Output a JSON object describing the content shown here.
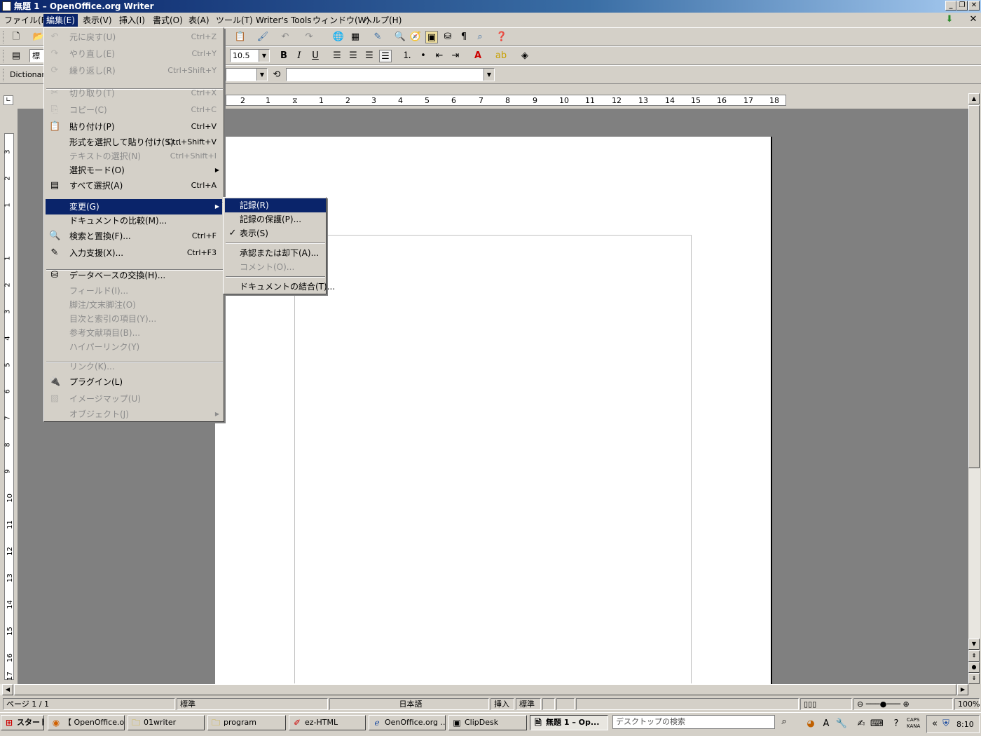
{
  "window": {
    "title": "無題 1 – OpenOffice.org Writer"
  },
  "menubar": [
    {
      "label": "ファイル(F)"
    },
    {
      "label": "編集(E)"
    },
    {
      "label": "表示(V)"
    },
    {
      "label": "挿入(I)"
    },
    {
      "label": "書式(O)"
    },
    {
      "label": "表(A)"
    },
    {
      "label": "ツール(T)"
    },
    {
      "label": "Writer's Tools"
    },
    {
      "label": "ウィンドウ(W)"
    },
    {
      "label": "ヘルプ(H)"
    }
  ],
  "toolbar": {
    "style_value": "標",
    "font_size_value": "10.5",
    "dictionary_label": "Dictionar"
  },
  "edit_menu": [
    {
      "label": "元に戻す(U)",
      "shortcut": "Ctrl+Z",
      "icon": "undo-icon"
    },
    {
      "label": "やり直し(E)",
      "shortcut": "Ctrl+Y",
      "icon": "redo-icon"
    },
    {
      "label": "繰り返し(R)",
      "shortcut": "Ctrl+Shift+Y",
      "icon": "repeat-icon"
    },
    {
      "label": "切り取り(T)",
      "shortcut": "Ctrl+X",
      "icon": "cut-icon"
    },
    {
      "label": "コピー(C)",
      "shortcut": "Ctrl+C",
      "icon": "copy-icon"
    },
    {
      "label": "貼り付け(P)",
      "shortcut": "Ctrl+V",
      "icon": "paste-icon"
    },
    {
      "label": "形式を選択して貼り付け(S)...",
      "shortcut": "Ctrl+Shift+V"
    },
    {
      "label": "テキストの選択(N)",
      "shortcut": "Ctrl+Shift+I"
    },
    {
      "label": "選択モード(O)"
    },
    {
      "label": "すべて選択(A)",
      "shortcut": "Ctrl+A",
      "icon": "select-all-icon"
    },
    {
      "label": "変更(G)"
    },
    {
      "label": "ドキュメントの比較(M)..."
    },
    {
      "label": "検索と置換(F)...",
      "shortcut": "Ctrl+F",
      "icon": "binoculars-icon"
    },
    {
      "label": "入力支援(X)...",
      "shortcut": "Ctrl+F3",
      "icon": "autotext-icon"
    },
    {
      "label": "データベースの交換(H)...",
      "icon": "database-icon"
    },
    {
      "label": "フィールド(I)..."
    },
    {
      "label": "脚注/文末脚注(O)"
    },
    {
      "label": "目次と索引の項目(Y)..."
    },
    {
      "label": "参考文献項目(B)..."
    },
    {
      "label": "ハイパーリンク(Y)"
    },
    {
      "label": "リンク(K)..."
    },
    {
      "label": "プラグイン(L)",
      "icon": "plugin-icon"
    },
    {
      "label": "イメージマップ(U)",
      "icon": "imagemap-icon"
    },
    {
      "label": "オブジェクト(J)"
    }
  ],
  "changes_submenu": [
    {
      "label": "記録(R)"
    },
    {
      "label": "記録の保護(P)..."
    },
    {
      "label": "表示(S)",
      "checked": "✓"
    },
    {
      "label": "承認または却下(A)..."
    },
    {
      "label": "コメント(O)..."
    },
    {
      "label": "ドキュメントの結合(T)..."
    }
  ],
  "ruler": {
    "h_ticks": [
      "2",
      "1",
      "1",
      "2",
      "3",
      "4",
      "5",
      "6",
      "7",
      "8",
      "9",
      "10",
      "11",
      "12",
      "13",
      "14",
      "15",
      "16",
      "17",
      "18"
    ],
    "v_ticks": [
      "3",
      "2",
      "1",
      "1",
      "2",
      "3",
      "4",
      "5",
      "6",
      "7",
      "8",
      "9",
      "10",
      "11",
      "12",
      "13",
      "14",
      "15",
      "16",
      "17"
    ]
  },
  "statusbar": {
    "page": "ページ 1 / 1",
    "style": "標準",
    "language": "日本語",
    "insert_mode": "挿入",
    "selection_mode": "標準",
    "zoom": "100%"
  },
  "taskbar": {
    "start": "スタート",
    "tasks": [
      {
        "label": "【 OpenOffice.o..."
      },
      {
        "label": "01writer"
      },
      {
        "label": "program"
      },
      {
        "label": "ez-HTML"
      },
      {
        "label": "OenOffice.org ..."
      },
      {
        "label": "ClipDesk"
      },
      {
        "label": "無題 1 – Op..."
      }
    ],
    "search_placeholder": "デスクトップの検索",
    "clock": "8:10",
    "caps": "CAPS",
    "kana": "KANA"
  }
}
